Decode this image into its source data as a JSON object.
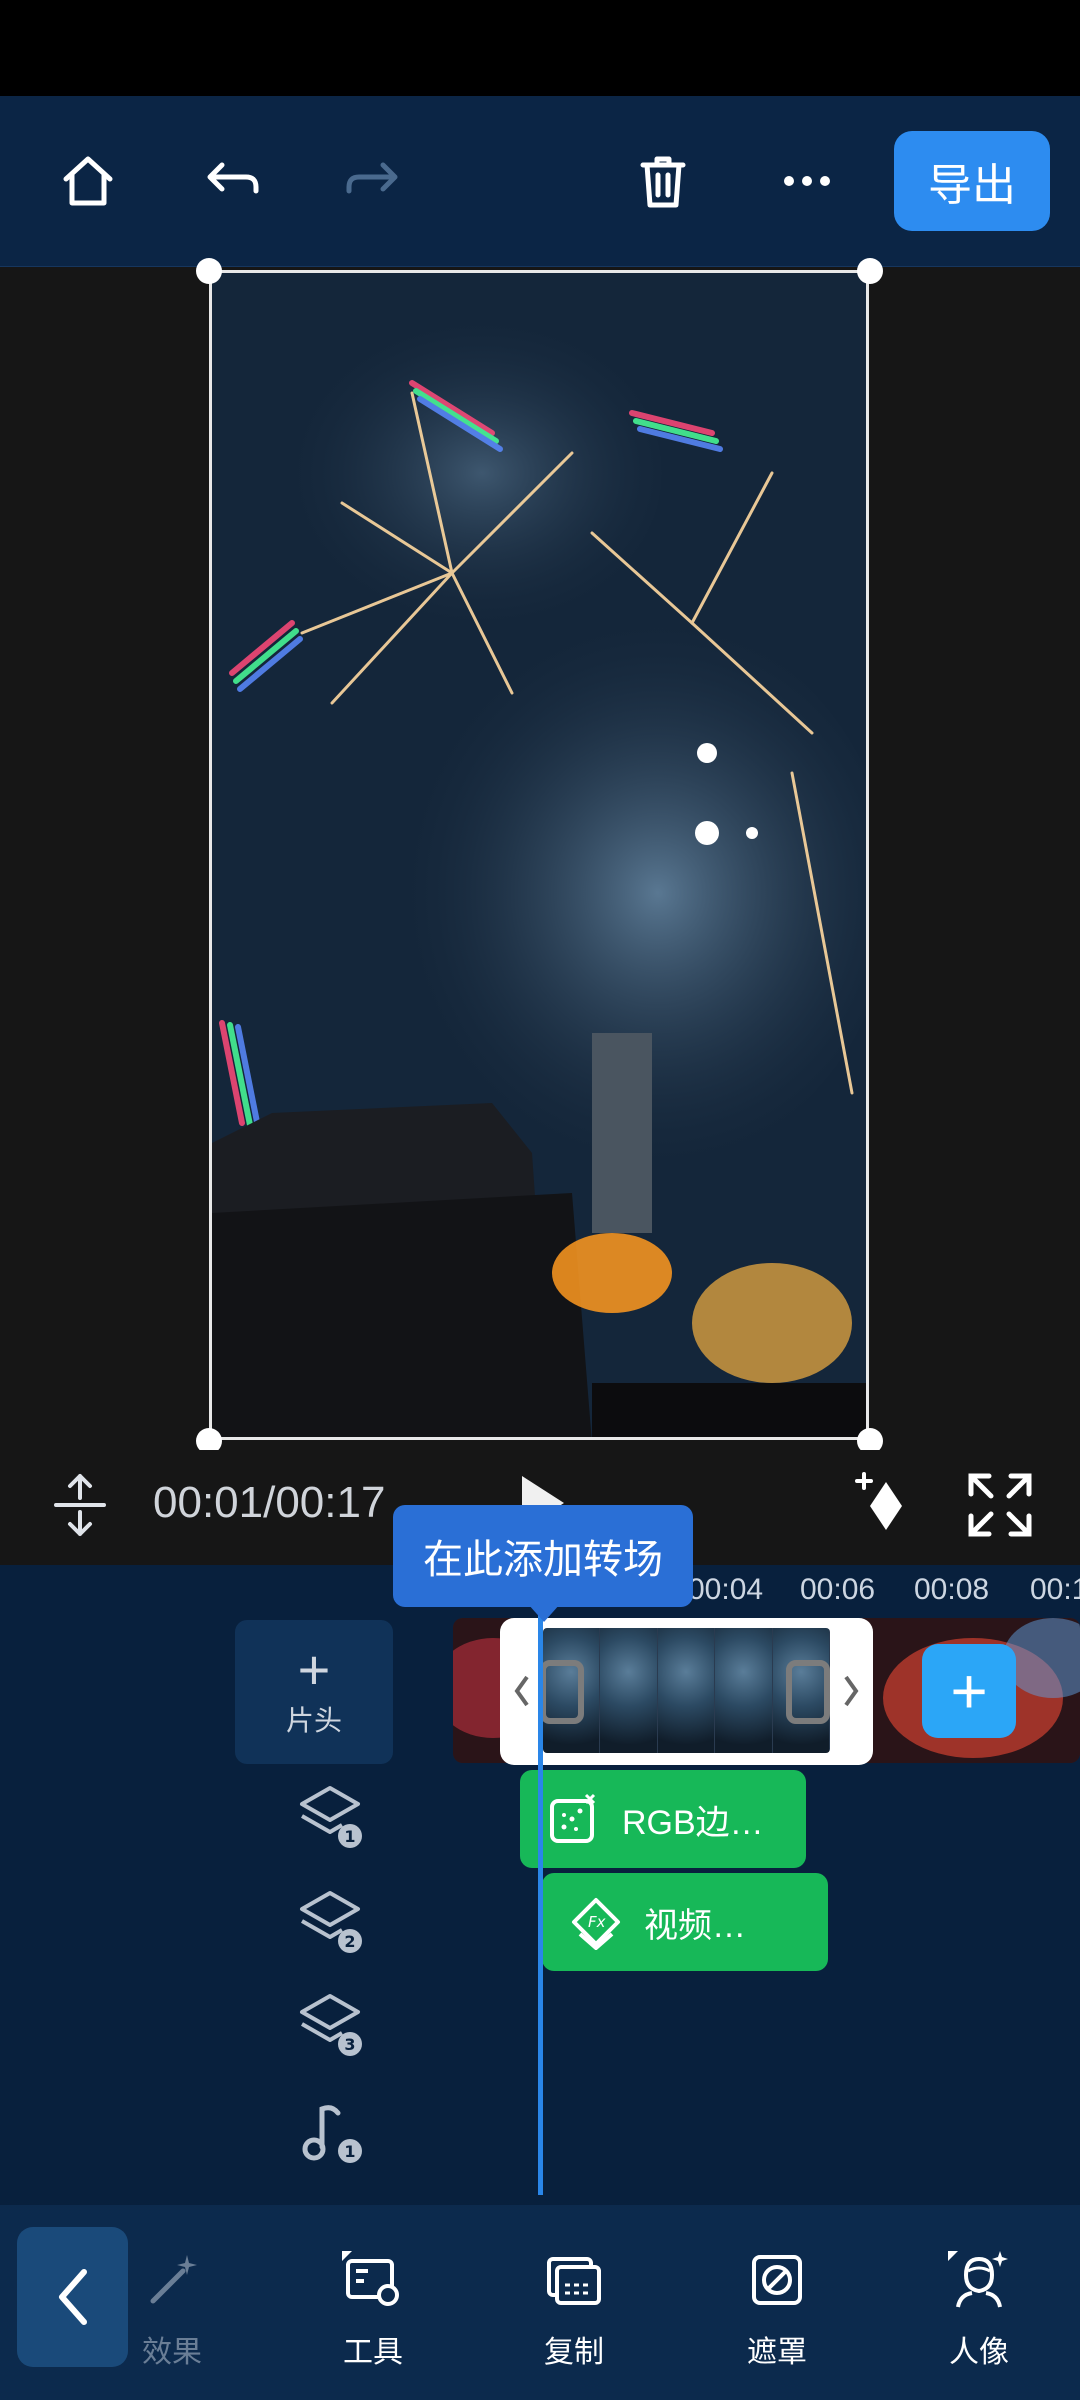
{
  "topbar": {
    "export_label": "导出"
  },
  "preview": {
    "timecode": "00:01/00:17"
  },
  "timeline": {
    "ruler": [
      "00:04",
      "00:06",
      "00:08",
      "00:1"
    ],
    "tooltip": "在此添加转场",
    "header_label": "片头",
    "header_plus": "+",
    "add_symbol": "+",
    "effects": [
      {
        "label": "RGB边…"
      },
      {
        "label": "视频…"
      }
    ],
    "tracks": [
      "1",
      "2",
      "3",
      "1"
    ]
  },
  "bottombar": {
    "tools": [
      {
        "label": "效果",
        "icon": "magic-wand-icon"
      },
      {
        "label": "工具",
        "icon": "tools-icon"
      },
      {
        "label": "复制",
        "icon": "copy-icon"
      },
      {
        "label": "遮罩",
        "icon": "mask-icon"
      },
      {
        "label": "人像",
        "icon": "portrait-icon"
      }
    ]
  },
  "colors": {
    "accent": "#2d8cf0",
    "effect_green": "#17b858",
    "playhead": "#2a86e8"
  }
}
